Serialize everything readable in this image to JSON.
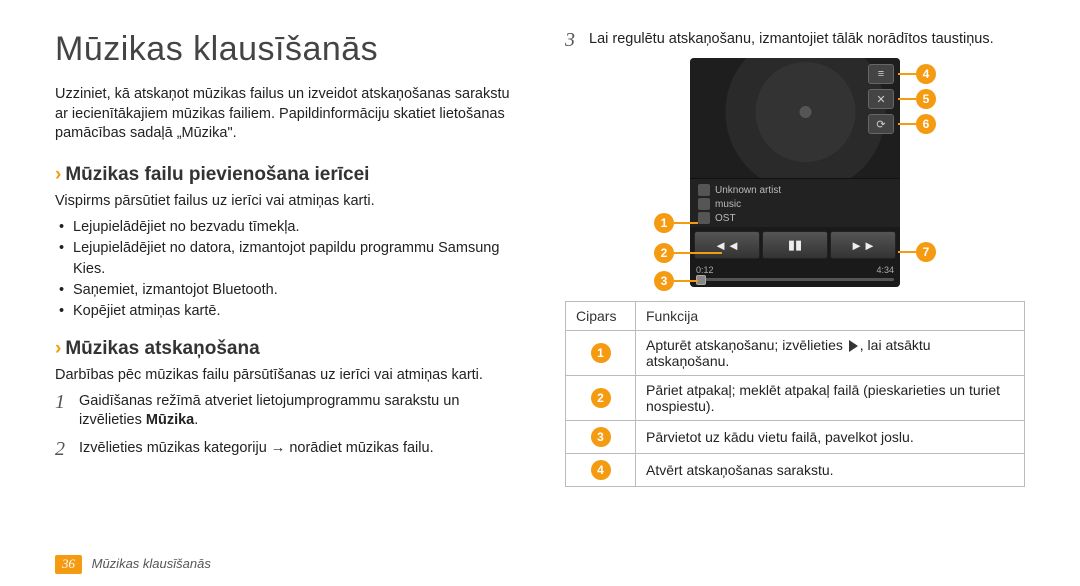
{
  "page": {
    "number": "36",
    "footer_title": "Mūzikas klausīšanās"
  },
  "heading": "Mūzikas klausīšanās",
  "intro": "Uzziniet, kā atskaņot mūzikas failus un izveidot atskaņošanas sarakstu ar iecienītākajiem mūzikas failiem. Papildinformāciju skatiet lietošanas pamācības sadaļā „Mūzika\".",
  "section1": {
    "title": "Mūzikas failu pievienošana ierīcei",
    "intro": "Vispirms pārsūtiet failus uz ierīci vai atmiņas karti.",
    "bullets": [
      "Lejupielādējiet no bezvadu tīmekļa.",
      "Lejupielādējiet no datora, izmantojot papildu programmu Samsung Kies.",
      "Saņemiet, izmantojot Bluetooth.",
      "Kopējiet atmiņas kartē."
    ]
  },
  "section2": {
    "title": "Mūzikas atskaņošana",
    "intro": "Darbības pēc mūzikas failu pārsūtīšanas uz ierīci vai atmiņas karti.",
    "steps": [
      {
        "n": "1",
        "text_pre": "Gaidīšanas režīmā atveriet lietojumprogrammu sarakstu un izvēlieties ",
        "text_bold": "Mūzika",
        "text_post": "."
      },
      {
        "n": "2",
        "text_pre": "Izvēlieties mūzikas kategoriju → norādiet mūzikas failu.",
        "text_bold": "",
        "text_post": ""
      },
      {
        "n": "3",
        "text_pre": "Lai regulētu atskaņošanu, izmantojiet tālāk norādītos taustiņus.",
        "text_bold": "",
        "text_post": ""
      }
    ]
  },
  "player": {
    "artist": "Unknown artist",
    "album": "music",
    "track": "OST",
    "elapsed": "0:12",
    "total": "4:34"
  },
  "table": {
    "head_num": "Cipars",
    "head_func": "Funkcija",
    "rows": [
      {
        "n": "1",
        "pre": "Apturēt atskaņošanu; izvēlieties ",
        "has_play": true,
        "post": ", lai atsāktu atskaņošanu."
      },
      {
        "n": "2",
        "pre": "Pāriet atpakaļ; meklēt atpakaļ failā (pieskarieties un turiet nospiestu).",
        "has_play": false,
        "post": ""
      },
      {
        "n": "3",
        "pre": "Pārvietot uz kādu vietu failā, pavelkot joslu.",
        "has_play": false,
        "post": ""
      },
      {
        "n": "4",
        "pre": "Atvērt atskaņošanas sarakstu.",
        "has_play": false,
        "post": ""
      }
    ]
  }
}
